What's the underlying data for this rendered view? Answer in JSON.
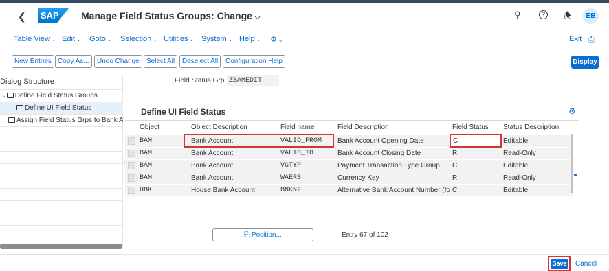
{
  "shell": {
    "logo": "SAP",
    "title": "Manage Field Status Groups: Change",
    "avatar": "EB"
  },
  "menu": [
    "Table View",
    "Edit",
    "Goto",
    "Selection",
    "Utilities",
    "System",
    "Help"
  ],
  "exit_label": "Exit",
  "toolbar": [
    "New Entries",
    "Copy As...",
    "Undo Change",
    "Select All",
    "Deselect All",
    "Configuration Help"
  ],
  "display_label": "Display",
  "dialog": {
    "title": "Dialog Structure",
    "items": [
      "Define Field Status Groups",
      "Define UI Field Status",
      "Assign Field Status Grps to Bank Ac"
    ]
  },
  "fsg": {
    "label": "Field Status Grp:",
    "value": "ZBAMEDIT"
  },
  "section_title": "Define UI Field Status",
  "table": {
    "columns": [
      "Object",
      "Object Description",
      "Field name",
      "Field Description",
      "Field Status",
      "Status Description"
    ],
    "rows": [
      [
        "BAM",
        "Bank Account",
        "VALID_FROM",
        "Bank Account Opening Date",
        "C",
        "Editable"
      ],
      [
        "BAM",
        "Bank Account",
        "VALID_TO",
        "Bank Account Closing Date",
        "R",
        "Read-Only"
      ],
      [
        "BAM",
        "Bank Account",
        "VGTYP",
        "Payment Transaction Type Group",
        "C",
        "Editable"
      ],
      [
        "BAM",
        "Bank Account",
        "WAERS",
        "Currency Key",
        "R",
        "Read-Only"
      ],
      [
        "HBK",
        "House Bank Account",
        "BNKN2",
        "Alternative Bank Account Number (for",
        "C",
        "Editable"
      ]
    ]
  },
  "position_label": "Position...",
  "entry_text": "Entry 67 of 102",
  "footer": {
    "save": "Save",
    "cancel": "Cancel"
  },
  "colors": {
    "accent": "#0a6ed1",
    "highlight": "#d43434"
  }
}
